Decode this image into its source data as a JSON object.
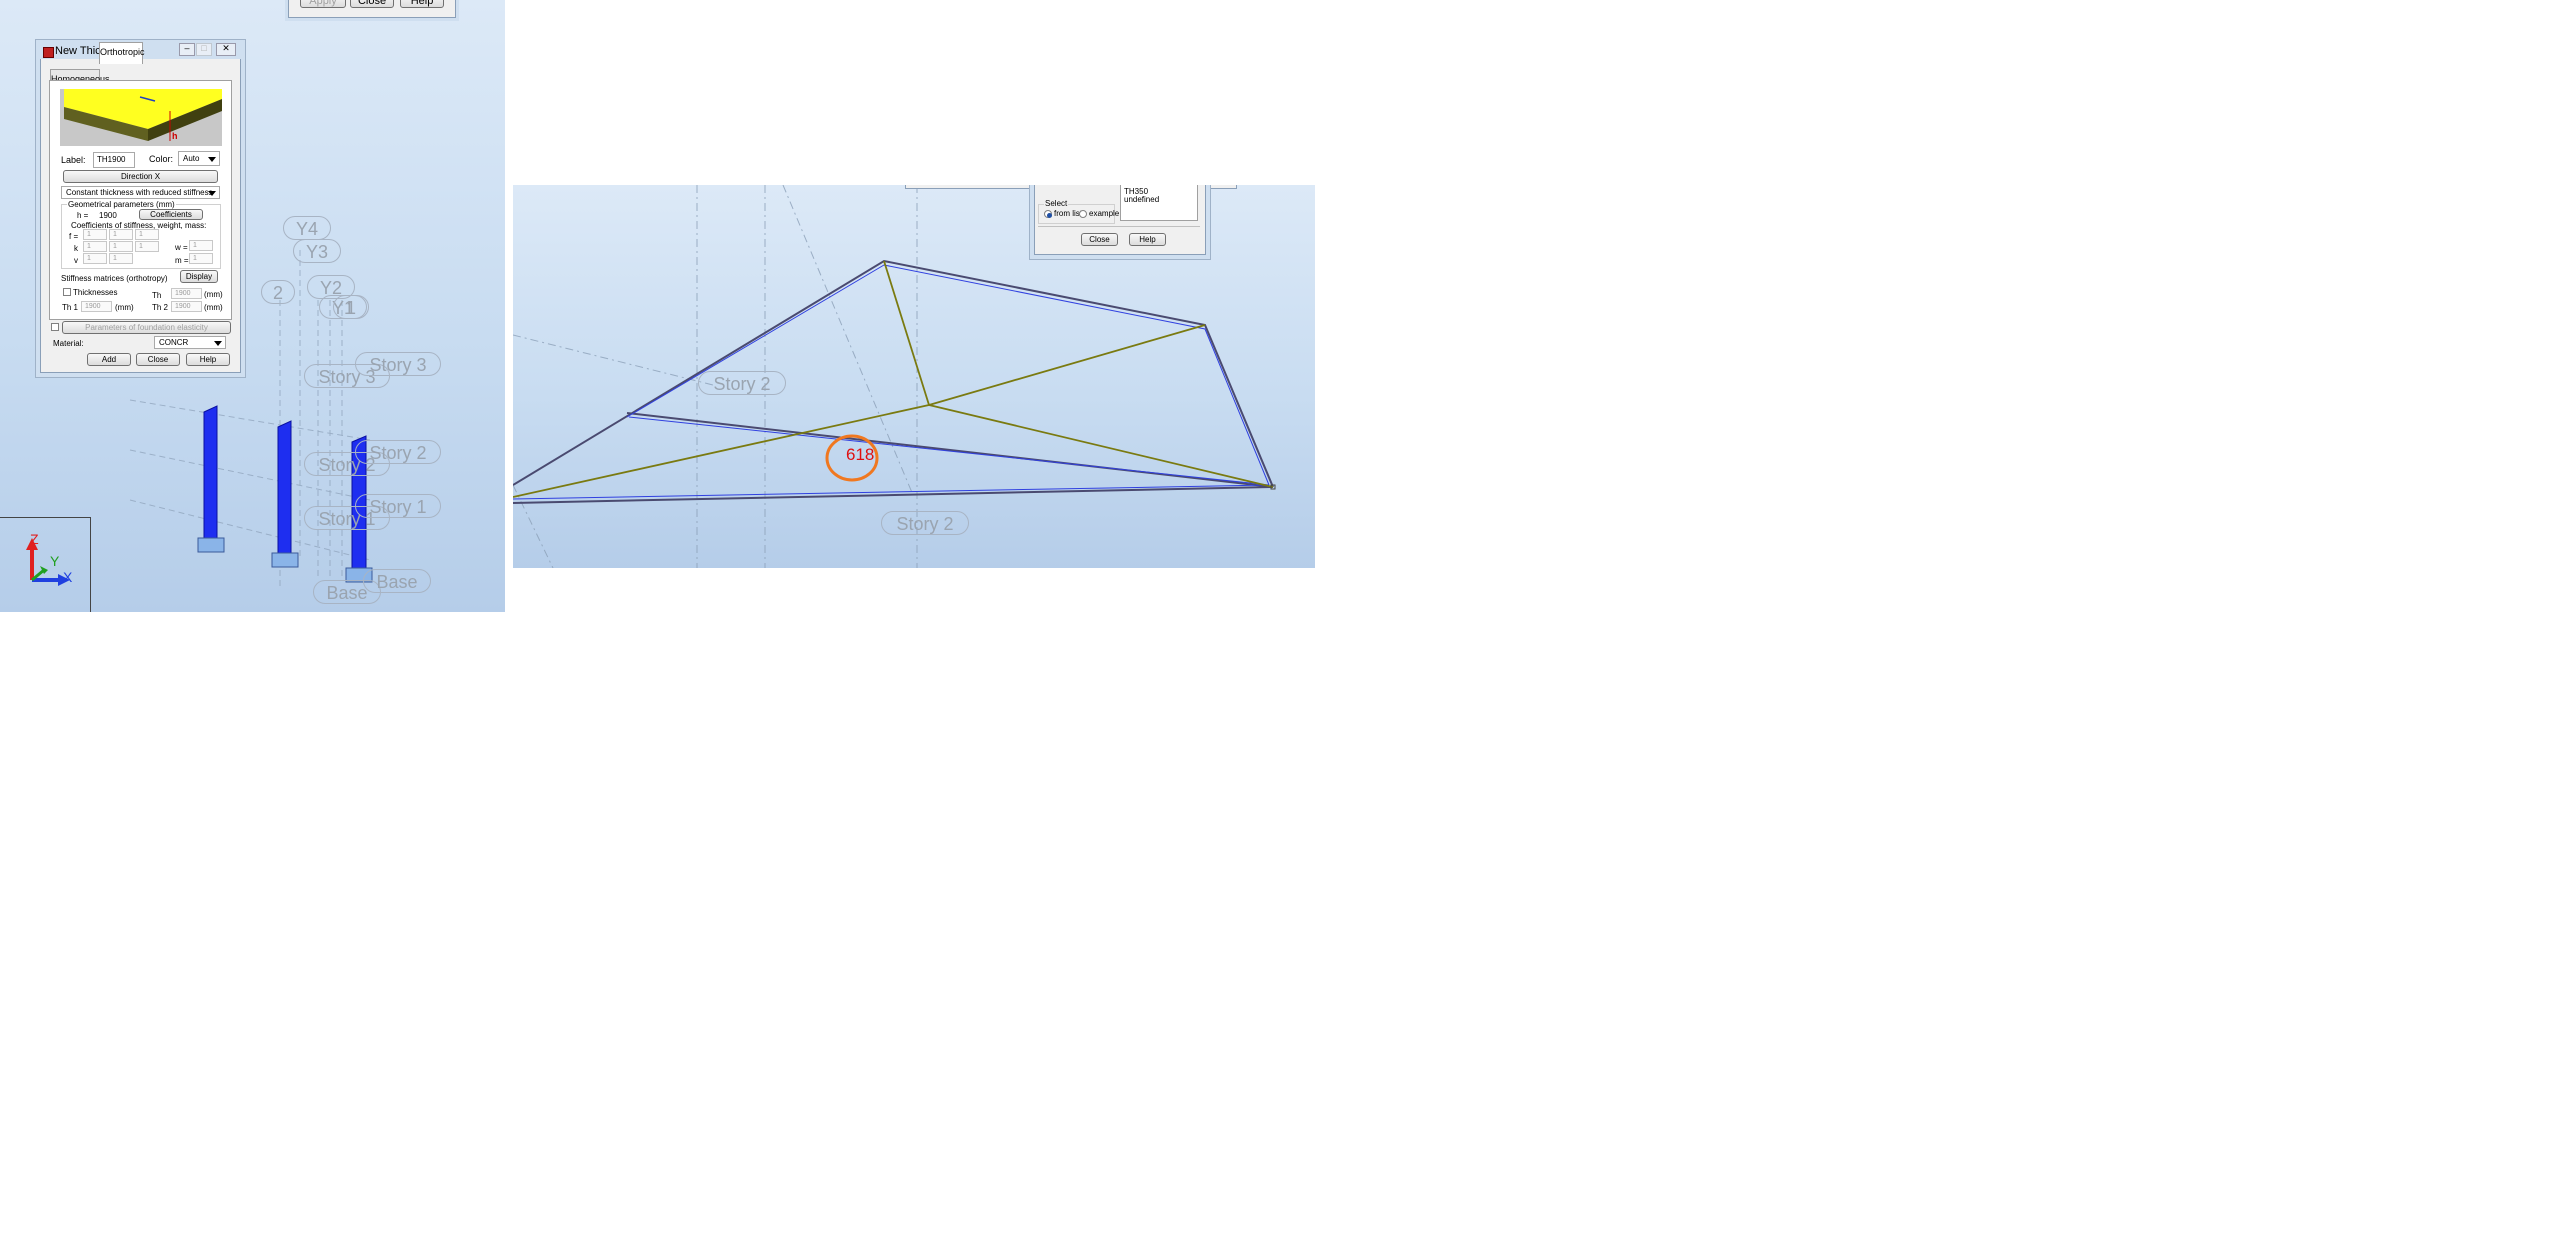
{
  "left_view": {
    "top_dialog_buttons": {
      "apply": "Apply",
      "close": "Close",
      "help": "Help"
    },
    "axis_labels": [
      "Y4",
      "Y3",
      "2",
      "Y2",
      "Y1",
      "1"
    ],
    "story_labels": [
      "Story 3",
      "Story 3",
      "Story 2",
      "Story 2",
      "Story 1",
      "Story 1",
      "Base",
      "Base"
    ],
    "axes_gizmo": {
      "z": "Z",
      "y": "Y",
      "x": "X"
    }
  },
  "new_thickness_dialog": {
    "title": "New Thickness",
    "tabs": [
      "Homogeneous",
      "Orthotropic"
    ],
    "active_tab": "Orthotropic",
    "diagram_label": "h",
    "label_caption": "Label:",
    "label_value": "TH1900",
    "color_caption": "Color:",
    "color_value": "Auto",
    "direction_button": "Direction X",
    "type_value": "Constant thickness with reduced stiffness",
    "geometry_group": "Geometrical parameters (mm)",
    "h_caption": "h  =",
    "h_value": "1900",
    "coefficients_button": "Coefficients",
    "coeff_group": "Coefficients of stiffness, weight, mass:",
    "f_caption": "f =",
    "f_values": [
      "1",
      "1",
      "1"
    ],
    "k_caption": "k",
    "k_values": [
      "1",
      "1",
      "1"
    ],
    "v_caption": "v",
    "v_values": [
      "1",
      "1"
    ],
    "w_caption": "w =",
    "w_value": "1",
    "m_caption": "m =",
    "m_value": "1",
    "stiffness_caption": "Stiffness matrices (orthotropy)",
    "display_button": "Display",
    "thicknesses_caption": "Thicknesses",
    "th_caption": "Th",
    "th_value": "1900",
    "th_unit": "(mm)",
    "th1_caption": "Th 1",
    "th1_value": "1900",
    "th1_unit": "(mm)",
    "th2_caption": "Th 2",
    "th2_value": "1900",
    "th2_unit": "(mm)",
    "foundation_button": "Parameters of foundation elasticity",
    "material_caption": "Material:",
    "material_value": "CONCR",
    "add_button": "Add",
    "close_button": "Close",
    "help_button": "Help"
  },
  "right_view": {
    "story_labels": [
      "Story 2",
      "Story 2"
    ],
    "node_number": "618",
    "dialog": {
      "list_items": [
        "TH350",
        "undefined"
      ],
      "select_group": "Select",
      "radio_from_list": "from list",
      "radio_example": "example",
      "selected_radio": "from list",
      "close_button": "Close",
      "help_button": "Help"
    }
  },
  "colors": {
    "wall_blue": "#1e2ef0",
    "frame_olive": "#7a7a10",
    "frame_dark": "#4a4a70",
    "highlight_circle": "#f07820",
    "node_number": "#e01010",
    "thickness_yellow": "#ffff20"
  }
}
